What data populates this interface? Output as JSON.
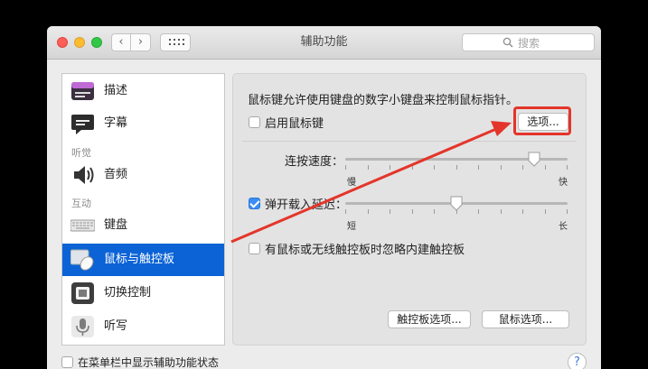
{
  "window": {
    "title": "辅助功能",
    "nav_back": "‹",
    "nav_forward": "›"
  },
  "search": {
    "placeholder": "搜索"
  },
  "sidebar": {
    "items": [
      {
        "label": "描述",
        "icon": "description-icon"
      },
      {
        "label": "字幕",
        "icon": "captions-icon"
      },
      {
        "label": "音频",
        "icon": "speaker-icon"
      },
      {
        "label": "键盘",
        "icon": "keyboard-icon"
      },
      {
        "label": "鼠标与触控板",
        "icon": "mouse-trackpad-icon",
        "selected": true
      },
      {
        "label": "切换控制",
        "icon": "switch-control-icon"
      },
      {
        "label": "听写",
        "icon": "microphone-icon"
      }
    ],
    "headers": {
      "hearing": "听觉",
      "interaction": "互动"
    }
  },
  "panel": {
    "intro": "鼠标键允许使用键盘的数字小键盘来控制鼠标指针。",
    "enable_mouse_keys": {
      "label": "启用鼠标键",
      "checked": false
    },
    "options_button": "选项...",
    "double_click_speed": {
      "label": "连按速度：",
      "min_label": "慢",
      "max_label": "快",
      "value": 0.85
    },
    "spring_loading": {
      "label": "弹开载入延迟：",
      "checked": true,
      "min_label": "短",
      "max_label": "长",
      "value": 0.5
    },
    "ignore_trackpad": {
      "label": "有鼠标或无线触控板时忽略内建触控板",
      "checked": false
    },
    "trackpad_options_button": "触控板选项...",
    "mouse_options_button": "鼠标选项..."
  },
  "footer": {
    "show_in_menu_bar": "在菜单栏中显示辅助功能状态",
    "help": "?"
  },
  "colors": {
    "selection": "#0b63d6",
    "annotation": "#e4352a",
    "checkbox_on": "#3a8ef5"
  }
}
